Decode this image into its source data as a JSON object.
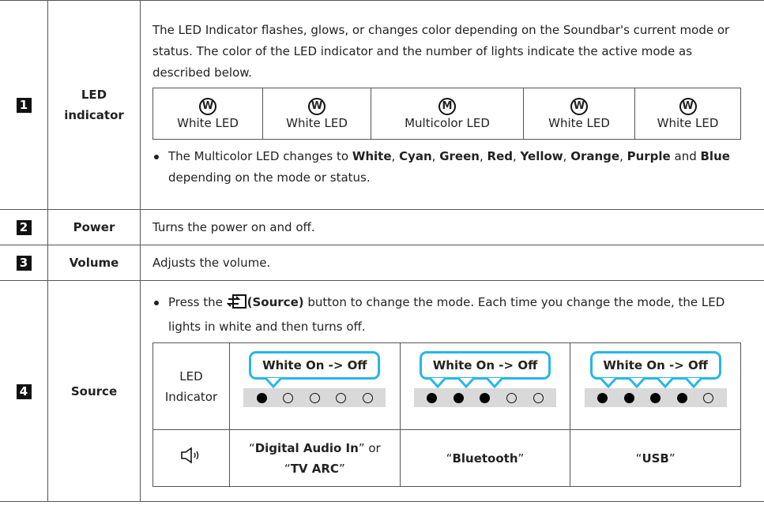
{
  "rows": [
    {
      "num": "1",
      "name_line1": "LED",
      "name_line2": "indicator"
    },
    {
      "num": "2",
      "name": "Power",
      "desc": "Turns the power on and off."
    },
    {
      "num": "3",
      "name": "Volume",
      "desc": "Adjusts the volume."
    },
    {
      "num": "4",
      "name": "Source"
    }
  ],
  "led": {
    "intro": "The LED Indicator flashes, glows, or changes color depending on the Soundbar's current mode or status. The color of the LED indicator and the number of lights indicate the active mode as described below.",
    "cells": [
      {
        "symbol": "W",
        "label": "White LED"
      },
      {
        "symbol": "W",
        "label": "White LED"
      },
      {
        "symbol": "M",
        "label": "Multicolor LED"
      },
      {
        "symbol": "W",
        "label": "White LED"
      },
      {
        "symbol": "W",
        "label": "White LED"
      }
    ],
    "note_prefix": "The Multicolor LED changes to ",
    "colors": [
      "White",
      "Cyan",
      "Green",
      "Red",
      "Yellow",
      "Orange",
      "Purple",
      "Blue"
    ],
    "sep_comma": ", ",
    "sep_and": " and ",
    "note_suffix": " depending on the mode or status."
  },
  "source": {
    "bullet_prefix": "Press the ",
    "bullet_button": "(Source)",
    "bullet_suffix": " button to change the mode. Each time you change the mode, the LED lights in white and then turns off.",
    "led_label_1": "LED",
    "led_label_2": "Indicator",
    "columns": [
      {
        "callout": "White On -> Off",
        "lit": 1,
        "total": 5,
        "q_open": "“",
        "mode": "Digital Audio In",
        "q_close": "”",
        "or_text": " or",
        "q_open2": "“",
        "mode2": "TV ARC",
        "q_close2": "”"
      },
      {
        "callout": "White On -> Off",
        "lit": 3,
        "total": 5,
        "q_open": "“",
        "mode": "Bluetooth",
        "q_close": "”"
      },
      {
        "callout": "White On -> Off",
        "lit": 4,
        "total": 5,
        "q_open": "“",
        "mode": "USB",
        "q_close": "”"
      }
    ],
    "speaker_icon": "speaker-voice-icon",
    "source_icon": "source-input-icon"
  },
  "colors": {
    "callout_border": "#27b7e6",
    "dot_strip": "#d9d9d9"
  }
}
